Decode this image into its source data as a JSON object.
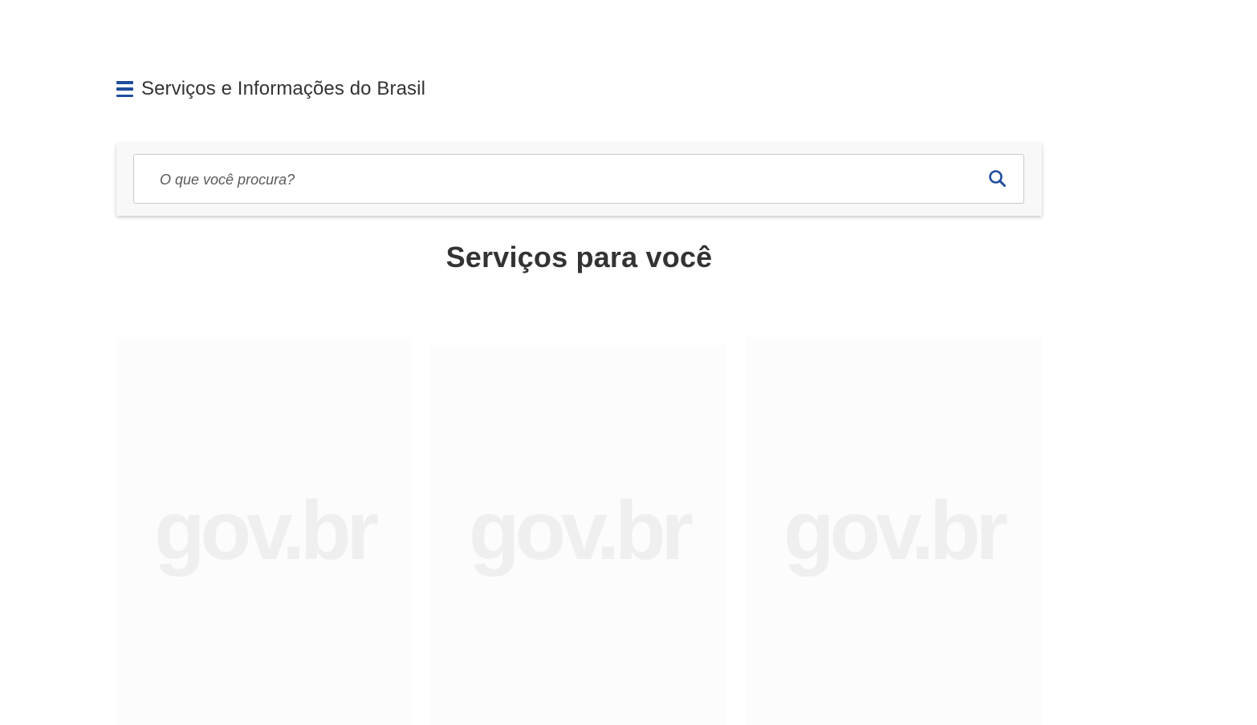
{
  "header": {
    "title": "Serviços e Informações do Brasil",
    "menu_icon": "hamburger-menu-icon",
    "accent_color": "#1e4e9c"
  },
  "search": {
    "placeholder": "O que você procura?",
    "icon": "search-icon"
  },
  "main": {
    "section_title": "Serviços para você",
    "cards": [
      {
        "placeholder_logo": "gov.br"
      },
      {
        "placeholder_logo": "gov.br"
      },
      {
        "placeholder_logo": "gov.br"
      }
    ]
  }
}
